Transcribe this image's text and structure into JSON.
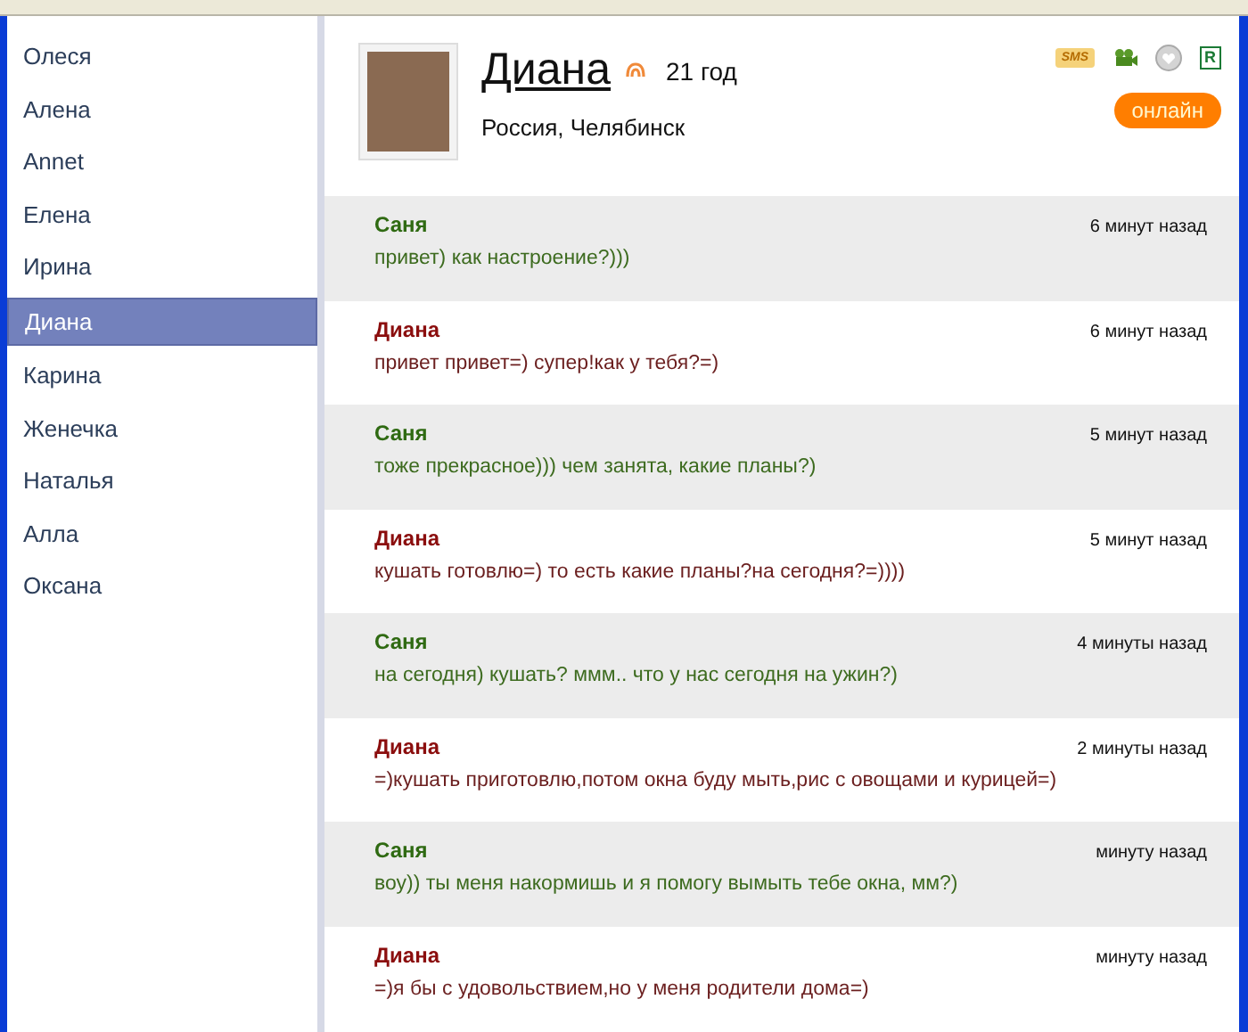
{
  "sidebar": {
    "items": [
      {
        "label": "Олеся",
        "selected": false
      },
      {
        "label": "Алена",
        "selected": false
      },
      {
        "label": "Annet",
        "selected": false
      },
      {
        "label": "Елена",
        "selected": false
      },
      {
        "label": "Ирина",
        "selected": false
      },
      {
        "label": "Диана",
        "selected": true
      },
      {
        "label": "Карина",
        "selected": false
      },
      {
        "label": "Женечка",
        "selected": false
      },
      {
        "label": "Наталья",
        "selected": false
      },
      {
        "label": "Алла",
        "selected": false
      },
      {
        "label": "Оксана",
        "selected": false
      }
    ]
  },
  "profile": {
    "name": "Диана",
    "age": "21 год",
    "location": "Россия, Челябинск",
    "status": "онлайн",
    "sms_badge": "SMS",
    "r_badge": "R"
  },
  "messages": [
    {
      "kind": "incoming",
      "sender": "Саня",
      "time": "6 минут назад",
      "text": "привет) как настроение?)))"
    },
    {
      "kind": "outgoing",
      "sender": "Диана",
      "time": "6 минут назад",
      "text": "привет привет=) супер!как у тебя?=)"
    },
    {
      "kind": "incoming",
      "sender": "Саня",
      "time": "5 минут назад",
      "text": "тоже прекрасное))) чем занята, какие планы?)"
    },
    {
      "kind": "outgoing",
      "sender": "Диана",
      "time": "5 минут назад",
      "text": "кушать готовлю=) то есть какие планы?на сегодня?=))))"
    },
    {
      "kind": "incoming",
      "sender": "Саня",
      "time": "4 минуты назад",
      "text": "на сегодня) кушать? ммм.. что у нас сегодня на ужин?)"
    },
    {
      "kind": "outgoing",
      "sender": "Диана",
      "time": "2 минуты назад",
      "text": "=)кушать приготовлю,потом окна буду мыть,рис с овощами и курицей=)"
    },
    {
      "kind": "incoming",
      "sender": "Саня",
      "time": "минуту назад",
      "text": "воу)) ты меня накормишь и я помогу вымыть тебе окна, мм?)"
    },
    {
      "kind": "outgoing",
      "sender": "Диана",
      "time": "минуту назад",
      "text": "=)я бы с удовольствием,но у меня родители дома=)"
    }
  ]
}
